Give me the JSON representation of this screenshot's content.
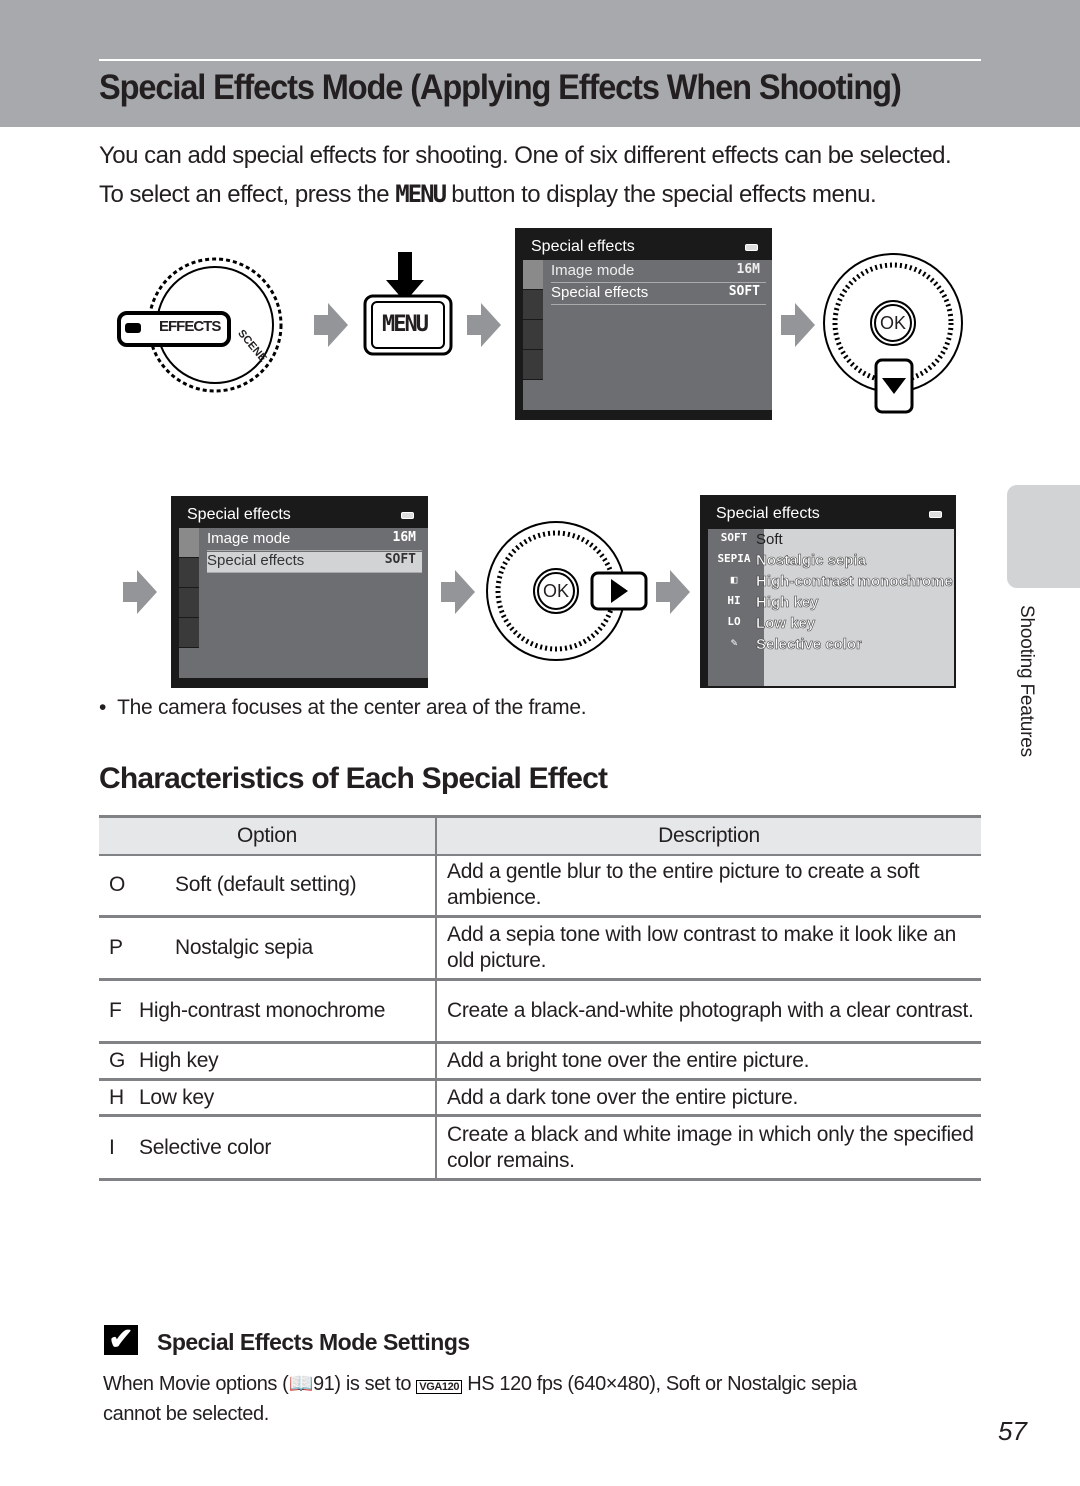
{
  "header": {
    "title": "Special Effects Mode (Applying Effects When Shooting)"
  },
  "intro": {
    "line1": "You can add special effects for shooting. One of six different effects can be selected.",
    "line2_pre": "To select an effect, press the ",
    "menu_key": "MENU",
    "line2_post": " button to display the special effects menu."
  },
  "dial": {
    "label": "EFFECTS",
    "scene": "SCENE"
  },
  "menu_button": {
    "label": "MENU"
  },
  "screen1": {
    "title": "Special effects",
    "rows": [
      {
        "label": "Image mode",
        "value": "16M"
      },
      {
        "label": "Special effects",
        "value": "SOFT"
      }
    ]
  },
  "screen2": {
    "title": "Special effects",
    "rows": [
      {
        "label": "Image mode",
        "value": "16M"
      },
      {
        "label": "Special effects",
        "value": "SOFT"
      }
    ]
  },
  "ok_label": "OK",
  "screen3": {
    "title": "Special effects",
    "items": [
      {
        "key": "SOFT",
        "label": "Soft"
      },
      {
        "key": "SEPIA",
        "label": "Nostalgic sepia"
      },
      {
        "key": "◧",
        "label": "High-contrast monochrome"
      },
      {
        "key": "HI",
        "label": "High key"
      },
      {
        "key": "LO",
        "label": "Low key"
      },
      {
        "key": "✎",
        "label": "Selective color"
      }
    ]
  },
  "bullet": "The camera focuses at the center area of the frame.",
  "section_title": "Characteristics of Each Special Effect",
  "table": {
    "headers": [
      "Option",
      "Description"
    ],
    "rows": [
      {
        "icon": "O",
        "option": "Soft (default setting)",
        "description": "Add a gentle blur to the entire picture to create a soft ambience."
      },
      {
        "icon": "P",
        "option": "Nostalgic sepia",
        "description": "Add a sepia tone with low contrast to make it look like an old picture."
      },
      {
        "icon": "F",
        "option": "High-contrast monochrome",
        "description": "Create a black-and-white photograph with a clear contrast."
      },
      {
        "icon": "G",
        "option": "High key",
        "description": "Add a bright tone over the entire picture."
      },
      {
        "icon": "H",
        "option": "Low key",
        "description": "Add a dark tone over the entire picture."
      },
      {
        "icon": "I",
        "option": "Selective color",
        "description": "Create a black and white image in which only the specified color remains."
      }
    ]
  },
  "side_tab": "Shooting Features",
  "note": {
    "icon": "check-icon",
    "title": "Special Effects Mode Settings",
    "p1": "When ",
    "b1": "Movie options",
    "p2": " (",
    "ref": "91",
    "p3": ") is set to ",
    "b2": "HS 120 fps (640×480)",
    "p4": ", ",
    "b3": "Soft",
    "p5": "  or ",
    "b4": "Nostalgic sepia",
    "p6": " cannot be selected."
  },
  "page_number": "57"
}
